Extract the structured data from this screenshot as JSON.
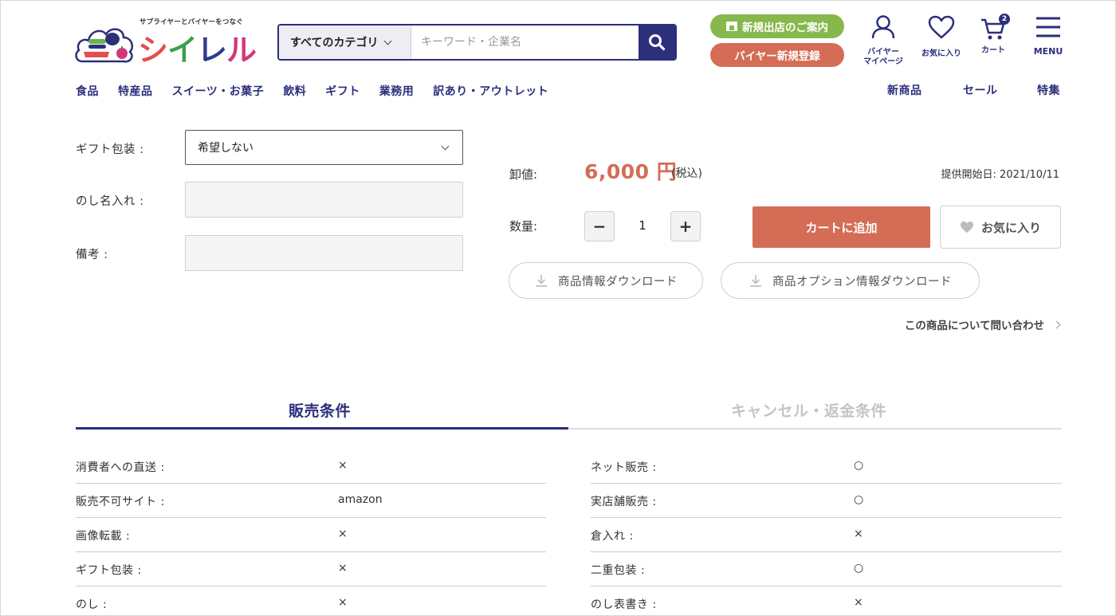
{
  "header": {
    "logo_tagline": "サプライヤーとバイヤーをつなぐ",
    "logo_wordmark": [
      "シ",
      "イ",
      "レ",
      "ル"
    ],
    "search": {
      "category_label": "すべてのカテゴリ",
      "placeholder": "キーワード・企業名"
    },
    "store_info_label": "新規出店のご案内",
    "buyer_register_label": "バイヤー新規登録",
    "icons": {
      "mypage_label_1": "バイヤー",
      "mypage_label_2": "マイページ",
      "favorites_label": "お気に入り",
      "cart_label": "カート",
      "cart_count": "2",
      "menu_label": "MENU"
    }
  },
  "nav": {
    "left": [
      "食品",
      "特産品",
      "スイーツ・お菓子",
      "飲料",
      "ギフト",
      "業務用",
      "訳あり・アウトレット"
    ],
    "right": [
      "新商品",
      "セール",
      "特集"
    ]
  },
  "form": {
    "gift_label": "ギフト包装 :",
    "gift_value": "希望しない",
    "noshi_label": "のし名入れ :",
    "note_label": "備考 :"
  },
  "price": {
    "wholesale_label": "卸値:",
    "amount": "6,000",
    "currency": "円",
    "tax_note": "(税込)",
    "start_date": "提供開始日: 2021/10/11",
    "quantity_label": "数量:",
    "minus": "−",
    "quantity": "1",
    "plus": "+",
    "add_to_cart": "カートに追加",
    "favorite": "お気に入り",
    "download_product": "商品情報ダウンロード",
    "download_options": "商品オプション情報ダウンロード",
    "inquiry": "この商品について問い合わせ"
  },
  "tabs": {
    "sales_conditions": "販売条件",
    "cancel_conditions": "キャンセル・返金条件"
  },
  "conditions": {
    "left": [
      {
        "label": "消費者への直送 :",
        "value": "×"
      },
      {
        "label": "販売不可サイト :",
        "value": "amazon"
      },
      {
        "label": "画像転載 :",
        "value": "×"
      },
      {
        "label": "ギフト包装 :",
        "value": "×"
      },
      {
        "label": "のし :",
        "value": "×"
      }
    ],
    "right": [
      {
        "label": "ネット販売 :",
        "value": "○"
      },
      {
        "label": "実店舗販売 :",
        "value": "○"
      },
      {
        "label": "倉入れ :",
        "value": "×"
      },
      {
        "label": "二重包装 :",
        "value": "○"
      },
      {
        "label": "のし表書き :",
        "value": "×"
      }
    ]
  },
  "colors": {
    "brand_navy": "#2b2f7c",
    "accent_red": "#d46c56",
    "accent_green": "#86b84b"
  }
}
